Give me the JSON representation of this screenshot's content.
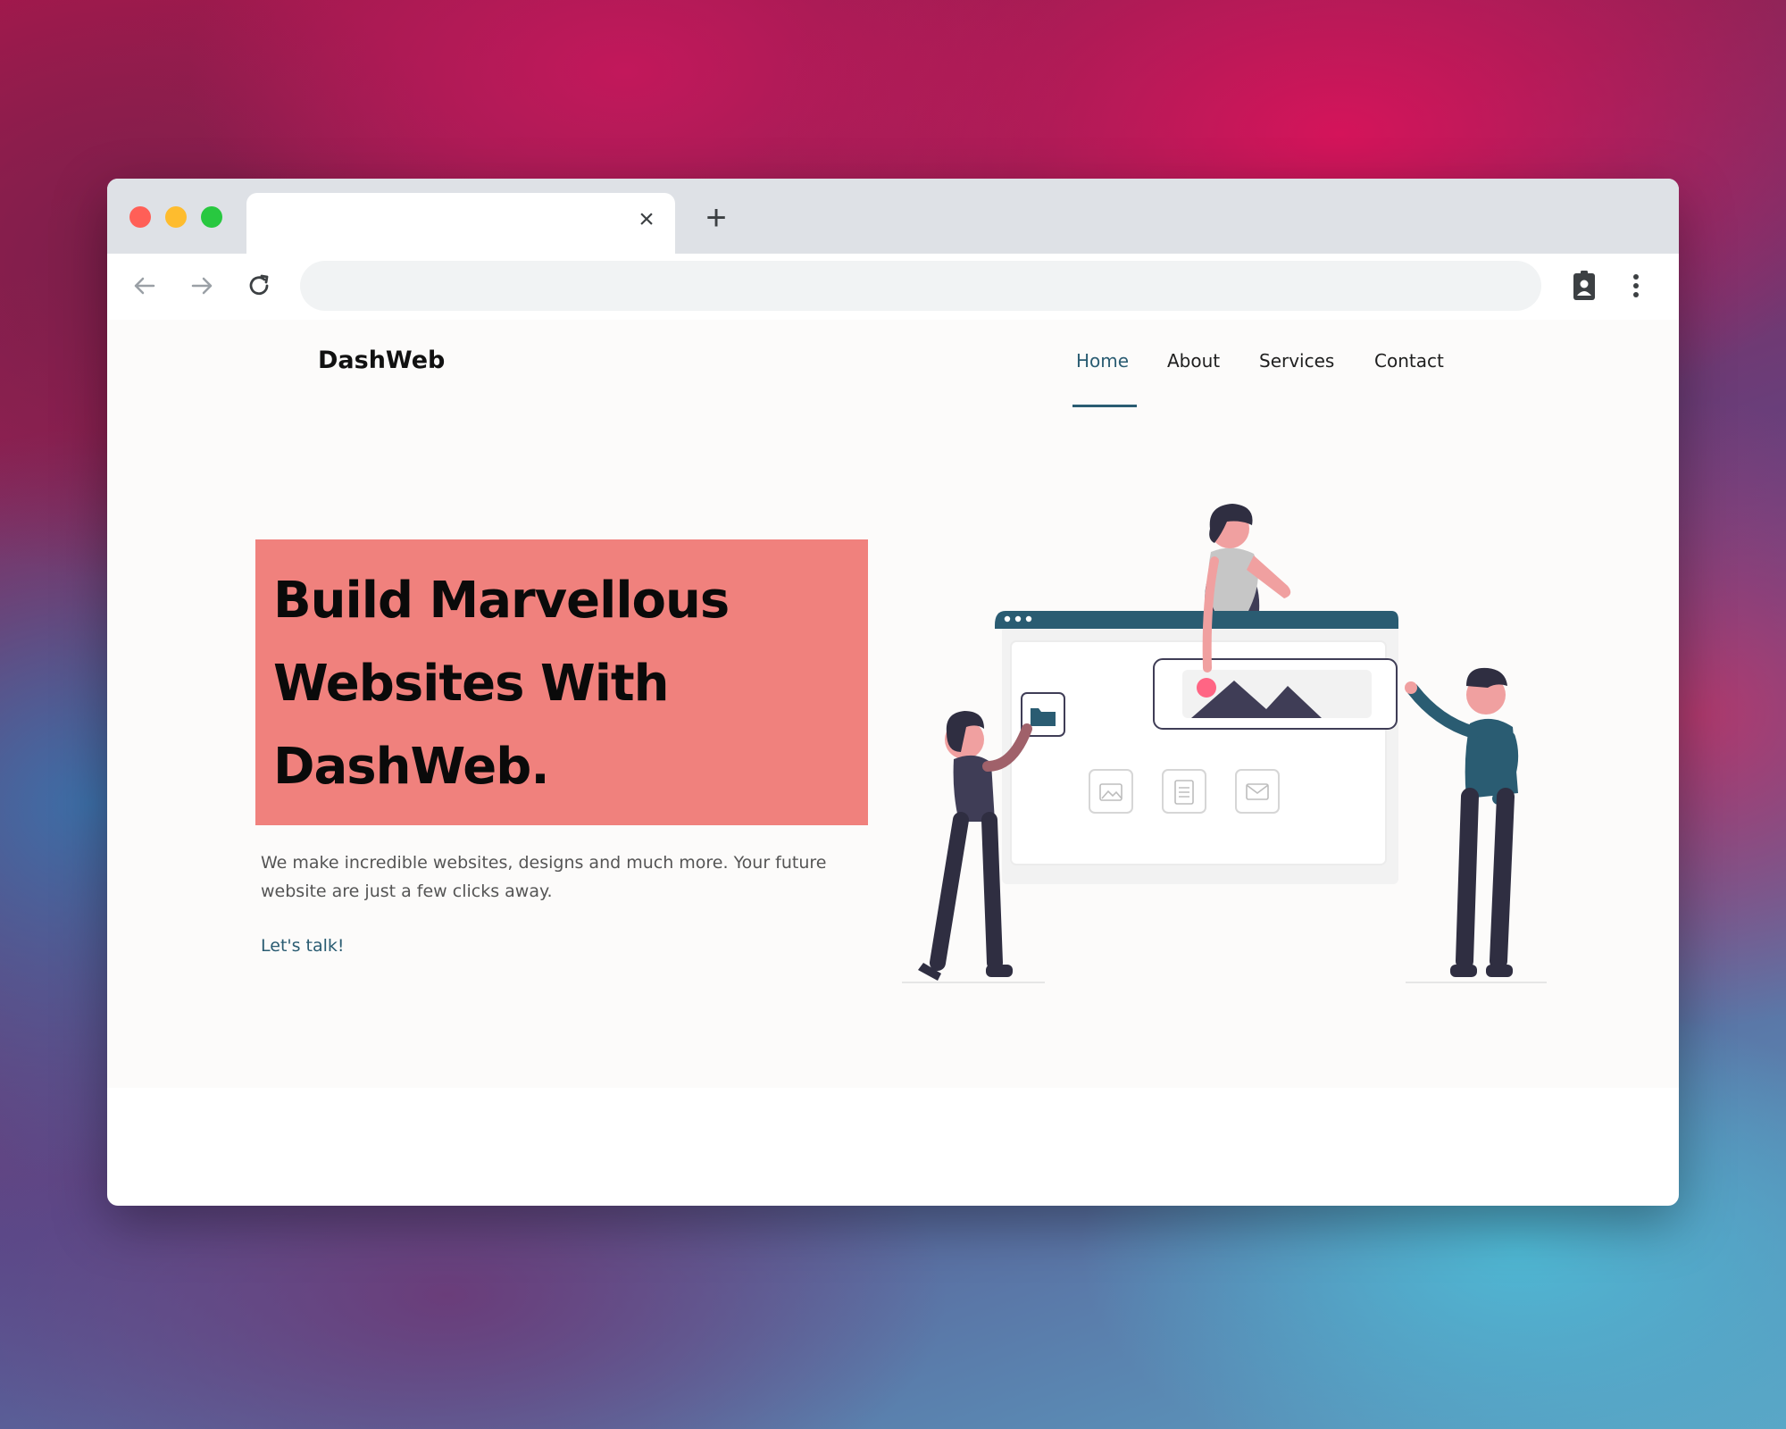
{
  "browser": {
    "tab_close_glyph": "×",
    "new_tab_glyph": "+",
    "address_value": ""
  },
  "site": {
    "brand": "DashWeb",
    "nav": [
      {
        "label": "Home",
        "active": true
      },
      {
        "label": "About",
        "active": false
      },
      {
        "label": "Services",
        "active": false
      },
      {
        "label": "Contact",
        "active": false
      }
    ]
  },
  "hero": {
    "title_lines": [
      "Build Marvellous",
      "Websites With",
      "DashWeb."
    ],
    "subtitle": "We make incredible websites, designs and much more. Your future website are just a few clicks away.",
    "cta": "Let's talk!"
  },
  "colors": {
    "accent": "#2a5c72",
    "hero_box": "#f0817d",
    "dark_figure": "#2f2e41"
  }
}
